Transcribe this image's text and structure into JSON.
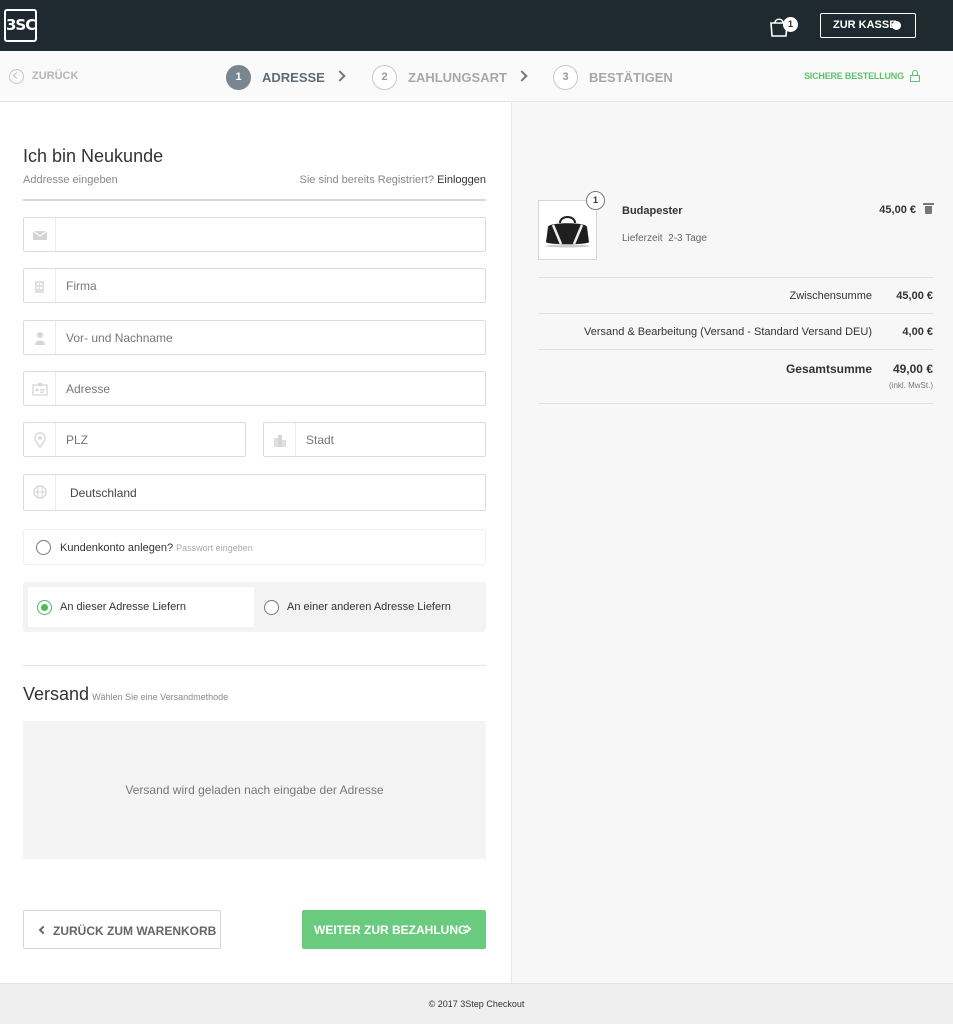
{
  "header": {
    "logo_text": "3SC",
    "cart_count": "1",
    "checkout_label": "ZUR KASSE"
  },
  "steps": {
    "back_label": "ZURÜCK",
    "items": [
      {
        "num": "1",
        "label": "ADRESSE",
        "active": true
      },
      {
        "num": "2",
        "label": "ZAHLUNGSART",
        "active": false
      },
      {
        "num": "3",
        "label": "BESTÄTIGEN",
        "active": false
      }
    ],
    "secure_label": "SICHERE BESTELLUNG"
  },
  "form": {
    "title": "Ich bin Neukunde",
    "subtitle": "Addresse eingeben",
    "login_question": "Sie sind bereits Registriert?",
    "login_link": "Einloggen",
    "email_placeholder": "",
    "company_placeholder": "Firma",
    "name_placeholder": "Vor- und Nachname",
    "address_placeholder": "Adresse",
    "zip_placeholder": "PLZ",
    "city_placeholder": "Stadt",
    "country_value": "Deutschland",
    "account_label": "Kundenkonto anlegen?",
    "account_hint": "Passwort eingeben",
    "delivery_same": "An dieser Adresse Liefern",
    "delivery_other": "An einer anderen Adresse Liefern",
    "delivery_selected": "same"
  },
  "shipping": {
    "title": "Versand",
    "hint": "Wählen Sie eine Versandmethode",
    "message": "Versand wird geladen nach eingabe der Adresse"
  },
  "buttons": {
    "back_to_cart": "ZURÜCK ZUM WARENKORB",
    "next": "WEITER ZUR BEZAHLUNG"
  },
  "summary": {
    "product": {
      "name": "Budapester",
      "qty": "1",
      "delivery_label": "Lieferzeit",
      "delivery_time": "2-3 Tage",
      "price": "45,00 €"
    },
    "subtotal_label": "Zwischensumme",
    "subtotal_value": "45,00 €",
    "shipping_label": "Versand & Bearbeitung (Versand - Standard Versand DEU)",
    "shipping_value": "4,00 €",
    "total_label": "Gesamtsumme",
    "total_value": "49,00 €",
    "vat_note": "(inkl. MwSt.)"
  },
  "footer": {
    "text": "© 2017 3Step Checkout"
  },
  "colors": {
    "header_bg": "#1e2a30",
    "accent_green": "#5cc36e",
    "button_green": "#6acb7e"
  }
}
